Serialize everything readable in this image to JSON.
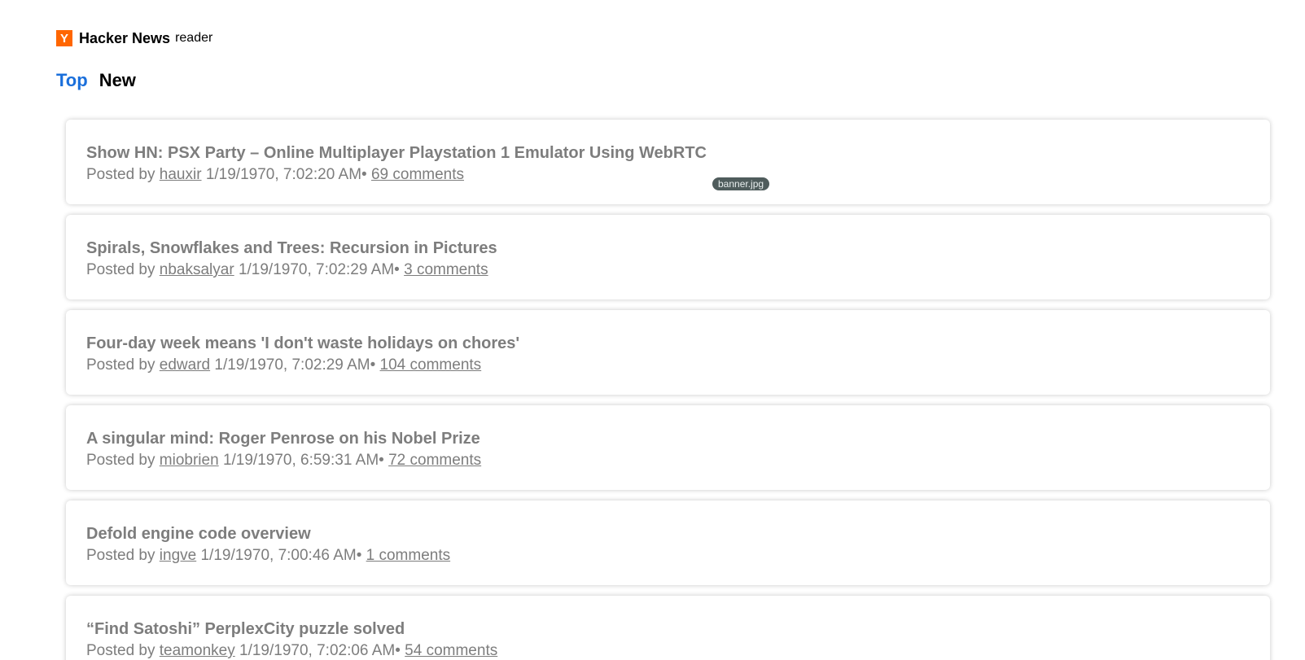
{
  "header": {
    "logo_letter": "Y",
    "site_name": "Hacker News",
    "site_sub": "reader"
  },
  "tabs": [
    {
      "label": "Top",
      "active": true
    },
    {
      "label": "New",
      "active": false
    }
  ],
  "stories": [
    {
      "title": "Show HN: PSX Party – Online Multiplayer Playstation 1 Emulator Using WebRTC",
      "posted_by": "Posted by",
      "author": "hauxir",
      "time": "1/19/1970, 7:02:20 AM",
      "separator": "•",
      "comments": "69 comments"
    },
    {
      "title": "Spirals, Snowflakes and Trees: Recursion in Pictures",
      "posted_by": "Posted by",
      "author": "nbaksalyar",
      "time": "1/19/1970, 7:02:29 AM",
      "separator": "•",
      "comments": "3 comments"
    },
    {
      "title": "Four-day week means 'I don't waste holidays on chores'",
      "posted_by": "Posted by",
      "author": "edward",
      "time": "1/19/1970, 7:02:29 AM",
      "separator": "•",
      "comments": "104 comments"
    },
    {
      "title": "A singular mind: Roger Penrose on his Nobel Prize",
      "posted_by": "Posted by",
      "author": "miobrien",
      "time": "1/19/1970, 6:59:31 AM",
      "separator": "•",
      "comments": "72 comments"
    },
    {
      "title": "Defold engine code overview",
      "posted_by": "Posted by",
      "author": "ingve",
      "time": "1/19/1970, 7:00:46 AM",
      "separator": "•",
      "comments": "1 comments"
    },
    {
      "title": "“Find Satoshi” PerplexCity puzzle solved",
      "posted_by": "Posted by",
      "author": "teamonkey",
      "time": "1/19/1970, 7:02:06 AM",
      "separator": "•",
      "comments": "54 comments"
    }
  ],
  "badge": {
    "label": "banner.jpg"
  },
  "colors": {
    "accent": "#1a6fdb",
    "logo": "#ff6600",
    "text_muted": "#7d7d7d"
  }
}
